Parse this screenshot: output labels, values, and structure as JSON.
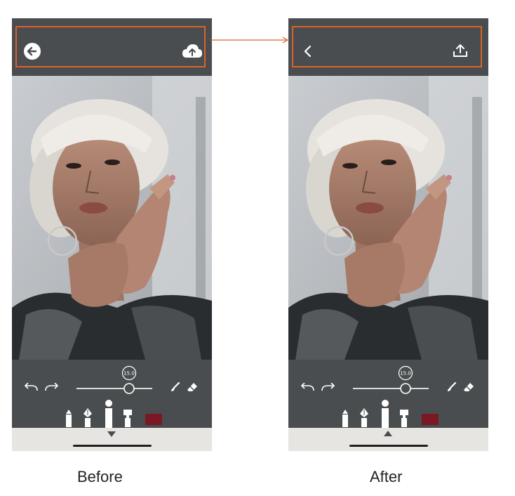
{
  "colors": {
    "bar": "#4a4d4f",
    "highlight": "#d9622a",
    "swatch": "#7a1826",
    "bottom_bar": "#e6e5e1"
  },
  "before": {
    "label": "Before",
    "back_icon": "circle-arrow-left-icon",
    "upload_icon": "cloud-upload-icon",
    "toggle_icon": "triangle-down-icon",
    "slider": {
      "value_text": "15.0",
      "value_fraction": 0.69
    }
  },
  "after": {
    "label": "After",
    "back_icon": "chevron-left-icon",
    "upload_icon": "share-upload-icon",
    "toggle_icon": "triangle-up-icon",
    "slider": {
      "value_text": "15.0",
      "value_fraction": 0.69
    }
  },
  "tool_icons": [
    "undo-icon",
    "redo-icon",
    "brush-icon",
    "eraser-icon",
    "marker-tool-icon",
    "pen-nib-tool-icon",
    "round-brush-tool-icon",
    "flat-brush-tool-icon"
  ]
}
